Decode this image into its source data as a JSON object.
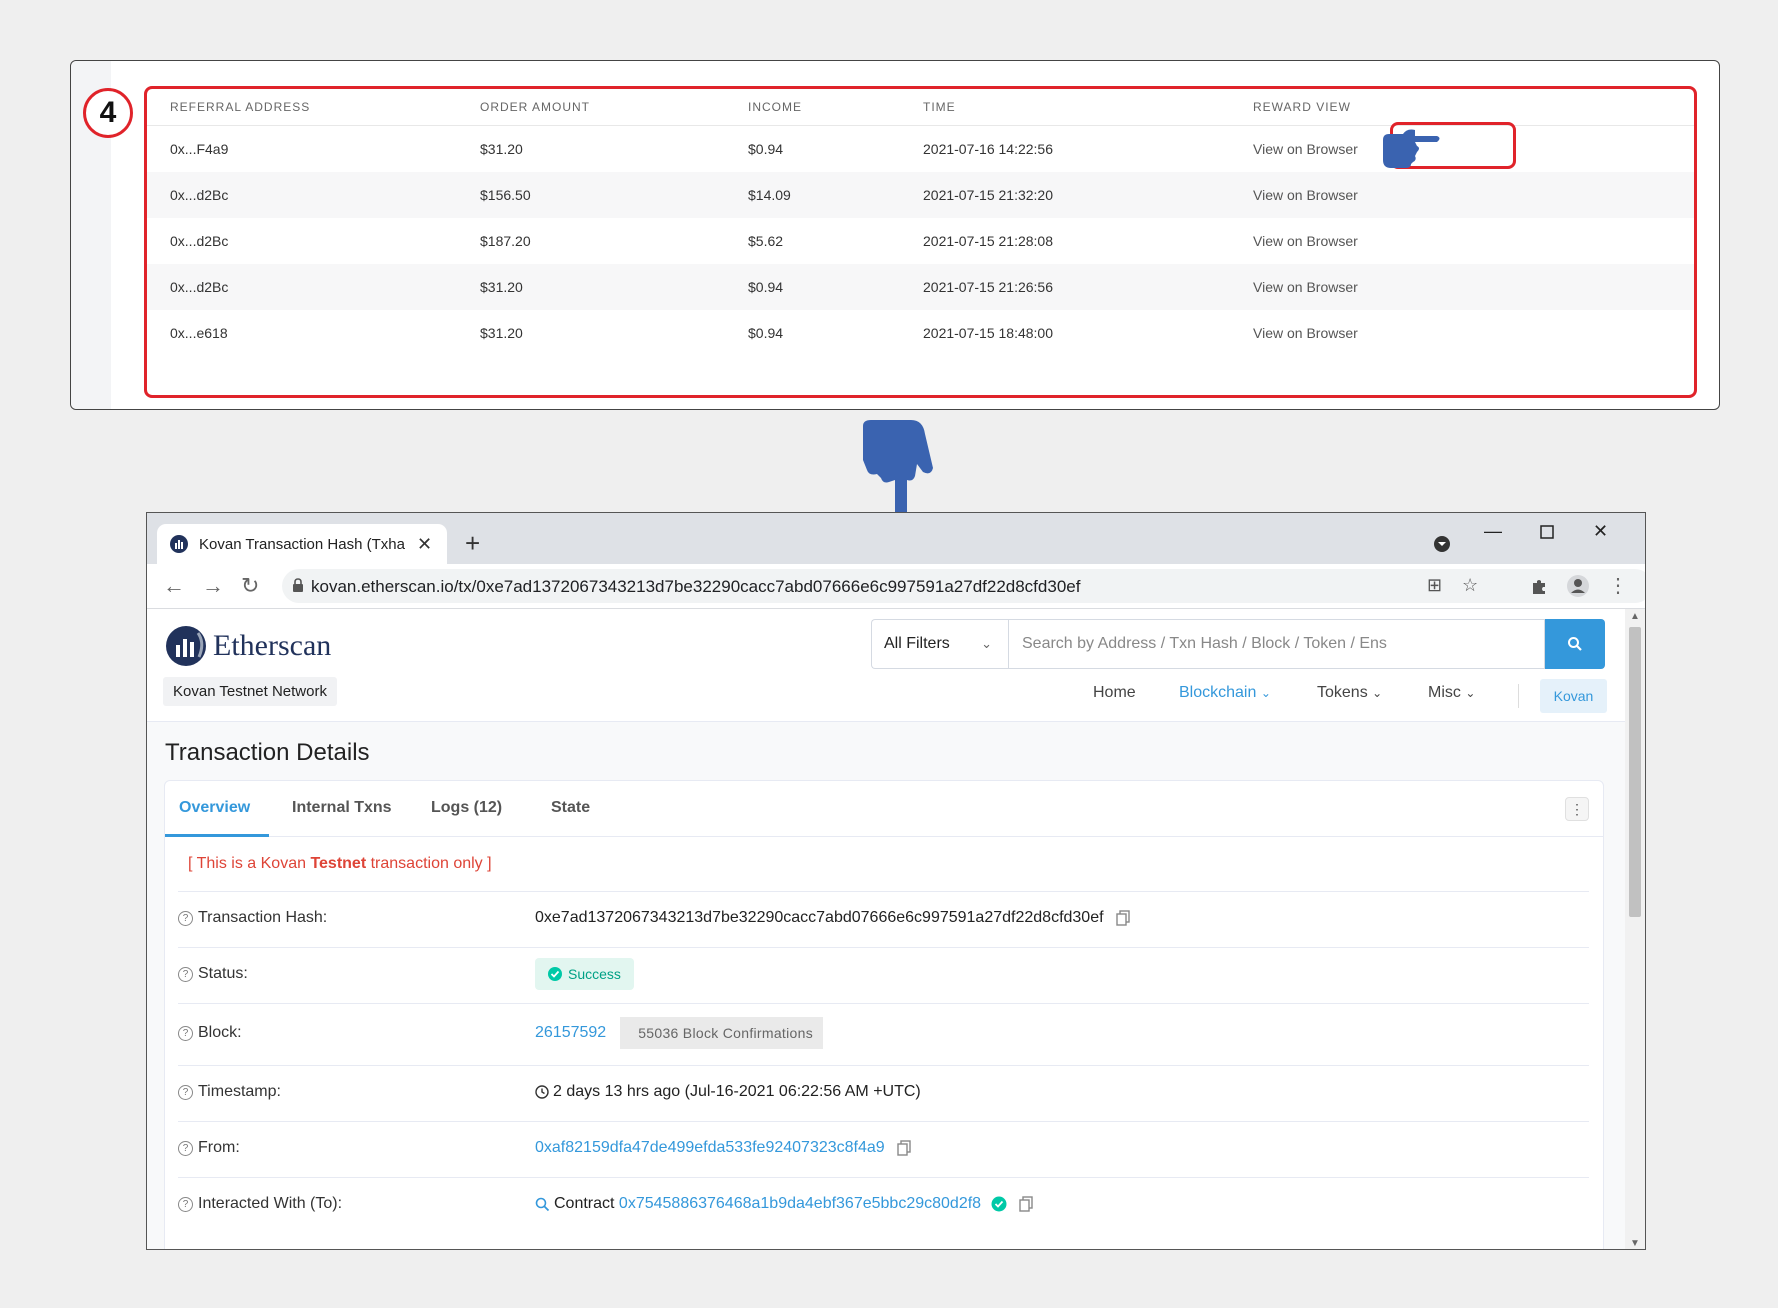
{
  "referral": {
    "step": "4",
    "headers": [
      "REFERRAL ADDRESS",
      "ORDER AMOUNT",
      "INCOME",
      "TIME",
      "REWARD VIEW"
    ],
    "rows": [
      {
        "address": "0x...F4a9",
        "amount": "$31.20",
        "income": "$0.94",
        "time": "2021-07-16 14:22:56",
        "view": "View on Browser"
      },
      {
        "address": "0x...d2Bc",
        "amount": "$156.50",
        "income": "$14.09",
        "time": "2021-07-15 21:32:20",
        "view": "View on Browser"
      },
      {
        "address": "0x...d2Bc",
        "amount": "$187.20",
        "income": "$5.62",
        "time": "2021-07-15 21:28:08",
        "view": "View on Browser"
      },
      {
        "address": "0x...d2Bc",
        "amount": "$31.20",
        "income": "$0.94",
        "time": "2021-07-15 21:26:56",
        "view": "View on Browser"
      },
      {
        "address": "0x...e618",
        "amount": "$31.20",
        "income": "$0.94",
        "time": "2021-07-15 18:48:00",
        "view": "View on Browser"
      }
    ]
  },
  "browser": {
    "tab_title": "Kovan Transaction Hash (Txha",
    "url": "kovan.etherscan.io/tx/0xe7ad1372067343213d7be32290cacc7abd07666e6c997591a27df22d8cfd30ef"
  },
  "site": {
    "logo": "Etherscan",
    "network": "Kovan Testnet Network",
    "filter": "All Filters",
    "search_placeholder": "Search by Address / Txn Hash / Block / Token / Ens",
    "nav": [
      "Home",
      "Blockchain",
      "Tokens",
      "Misc"
    ],
    "network_button": "Kovan"
  },
  "tx": {
    "title": "Transaction Details",
    "tabs": [
      "Overview",
      "Internal Txns",
      "Logs (12)",
      "State"
    ],
    "note_prefix": "[ This is a Kovan ",
    "note_bold": "Testnet",
    "note_suffix": " transaction only ]",
    "fields": {
      "hash_label": "Transaction Hash:",
      "hash": "0xe7ad1372067343213d7be32290cacc7abd07666e6c997591a27df22d8cfd30ef",
      "status_label": "Status:",
      "status": "Success",
      "block_label": "Block:",
      "block": "26157592",
      "confirmations": "55036 Block Confirmations",
      "timestamp_label": "Timestamp:",
      "timestamp": "2 days 13 hrs ago (Jul-16-2021 06:22:56 AM +UTC)",
      "from_label": "From:",
      "from": "0xaf82159dfa47de499efda533fe92407323c8f4a9",
      "to_label": "Interacted With (To):",
      "to_prefix": "Contract",
      "to": "0x7545886376468a1b9da4ebf367e5bbc29c80d2f8"
    }
  },
  "colors": {
    "highlight": "#e0232a",
    "hand": "#3a63b0",
    "accent": "#3498db"
  }
}
